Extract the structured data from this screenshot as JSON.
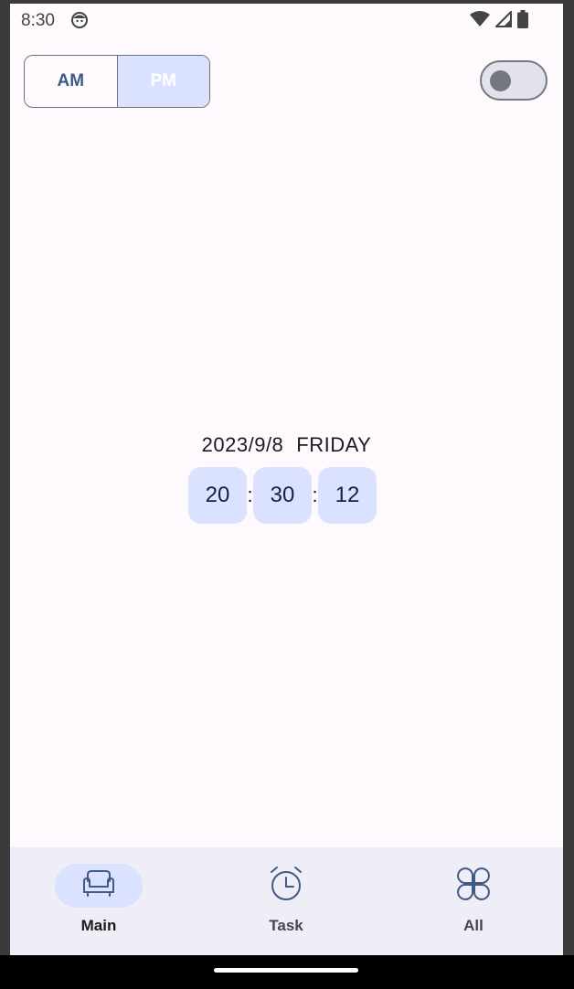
{
  "status_bar": {
    "time": "8:30",
    "icons": [
      "android-face-icon",
      "wifi-icon",
      "signal-icon",
      "battery-icon"
    ]
  },
  "mode_toggle": {
    "am_label": "AM",
    "pm_label": "PM",
    "selected": "PM"
  },
  "switch": {
    "on": false
  },
  "datetime": {
    "date": "2023/9/8",
    "weekday": "FRIDAY",
    "hour": "20",
    "minute": "30",
    "second": "12",
    "separator": ":"
  },
  "bottom_nav": {
    "items": [
      {
        "label": "Main",
        "icon": "armchair-icon",
        "active": true
      },
      {
        "label": "Task",
        "icon": "alarm-clock-icon",
        "active": false
      },
      {
        "label": "All",
        "icon": "clover-grid-icon",
        "active": false
      }
    ]
  },
  "colors": {
    "accent_container": "#dae2ff",
    "background": "#fdf9fd",
    "nav_background": "#efedf6",
    "icon_tint": "#3f5a85"
  }
}
